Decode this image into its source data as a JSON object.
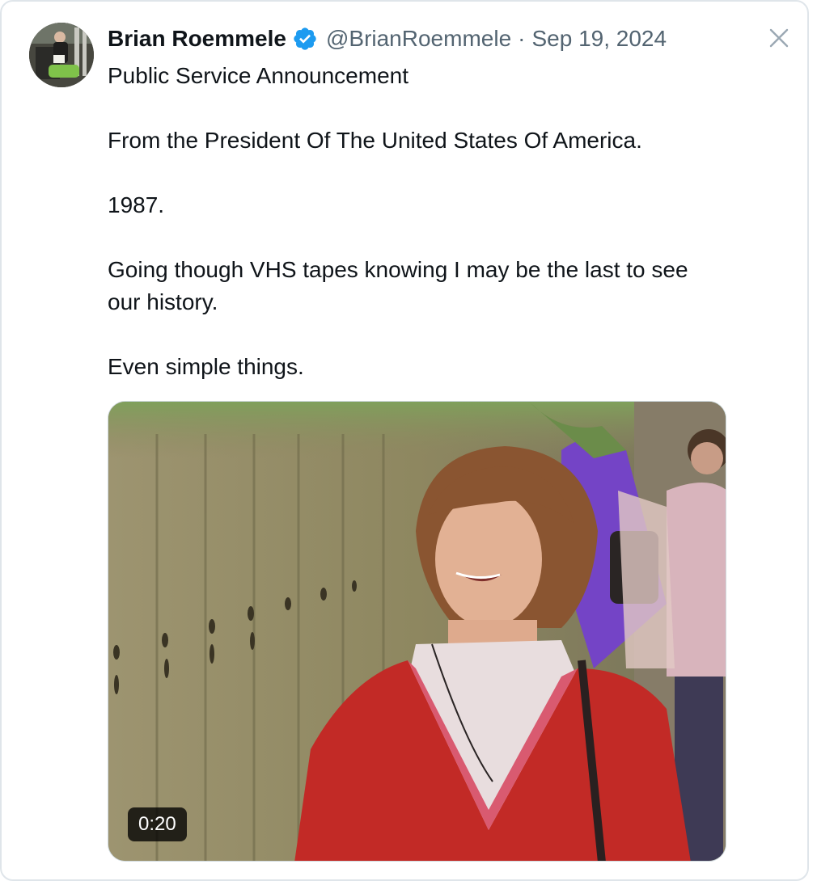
{
  "tweet": {
    "author_name": "Brian Roemmele",
    "handle": "@BrianRoemmele",
    "separator": "·",
    "date": "Sep 19, 2024",
    "paragraphs": [
      "Public Service Announcement",
      "From the President Of The United States Of America.",
      "1987.",
      "Going though VHS tapes knowing I may be the last to see our history.",
      "Even simple things."
    ],
    "verified": true,
    "media": {
      "type": "video",
      "duration": "0:20"
    }
  },
  "icons": {
    "verified": "verified-badge-icon",
    "close": "close-icon"
  },
  "colors": {
    "verified_blue": "#1d9bf0",
    "secondary_text": "#536471",
    "primary_text": "#0f1419",
    "border": "#dfe5ea"
  }
}
